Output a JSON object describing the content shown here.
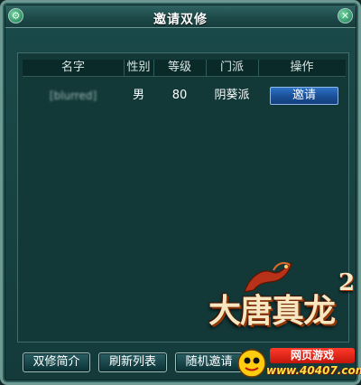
{
  "window": {
    "title": "邀请双修",
    "menu_icon": "gear-icon",
    "close_icon": "close-icon"
  },
  "list": {
    "columns": [
      "名字",
      "性别",
      "等级",
      "门派",
      "操作"
    ],
    "rows": [
      {
        "name": "[blurred]",
        "gender": "男",
        "level": "80",
        "sect": "阴葵派",
        "action": "邀请"
      }
    ]
  },
  "footer": {
    "buttons": [
      "双修简介",
      "刷新列表",
      "随机邀请"
    ]
  },
  "branding": {
    "logo_text": "大唐真龙",
    "logo_sup": "2",
    "promo_top": "网页游戏",
    "promo_url": "www.40407.com"
  },
  "colors": {
    "panel_bg": "#184242",
    "invite_button": "#1a4f97",
    "promo_red": "#e0231a",
    "promo_yellow": "#ffe241"
  }
}
